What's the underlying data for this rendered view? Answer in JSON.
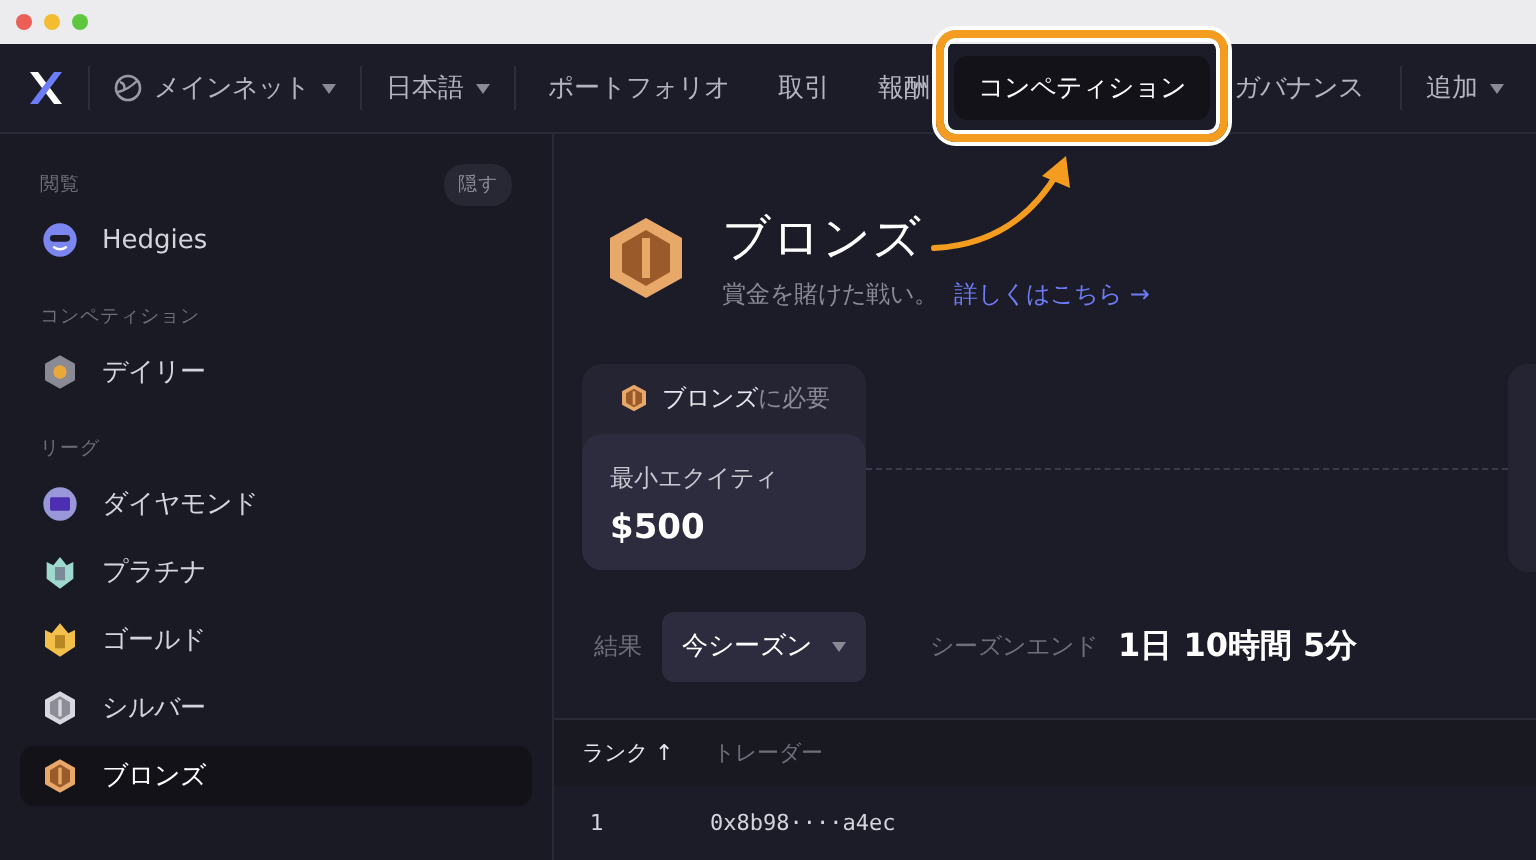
{
  "nav": {
    "network": {
      "label": "メインネット"
    },
    "language": {
      "label": "日本語"
    },
    "items": [
      {
        "label": "ポートフォリオ",
        "selected": false,
        "highlighted": false
      },
      {
        "label": "取引",
        "selected": false,
        "highlighted": false
      },
      {
        "label": "報酬",
        "selected": false,
        "highlighted": false
      },
      {
        "label": "コンペティション",
        "selected": true,
        "highlighted": true
      },
      {
        "label": "ガバナンス",
        "selected": false,
        "highlighted": false
      }
    ],
    "more": {
      "label": "追加"
    }
  },
  "sidebar": {
    "sections": [
      {
        "heading": "閲覧",
        "action": "隠す",
        "items": [
          {
            "label": "Hedgies",
            "kind": "hedgie",
            "selected": false
          }
        ]
      },
      {
        "heading": "コンペティション",
        "items": [
          {
            "label": "デイリー",
            "kind": "daily",
            "selected": false
          }
        ]
      },
      {
        "heading": "リーグ",
        "items": [
          {
            "label": "ダイヤモンド",
            "kind": "diamond",
            "selected": false
          },
          {
            "label": "プラチナ",
            "kind": "platinum",
            "selected": false
          },
          {
            "label": "ゴールド",
            "kind": "gold",
            "selected": false
          },
          {
            "label": "シルバー",
            "kind": "silver",
            "selected": false
          },
          {
            "label": "ブロンズ",
            "kind": "bronze",
            "selected": true
          }
        ]
      }
    ]
  },
  "league": {
    "kind": "bronze",
    "title": "ブロンズ",
    "subtitle": "賞金を賭けた戦い。",
    "link": "詳しくはこちら →"
  },
  "requirements": {
    "kind": "bronze",
    "label": "**ブロンズ**に必要",
    "metric": "最小エクイティ",
    "value": "$500"
  },
  "results": {
    "label": "結果",
    "season": "今シーズン",
    "season_end_label": "シーズンエンド",
    "season_end": "1日 10時間 5分",
    "columns": [
      {
        "label": "ランク ↑",
        "sorted": true
      },
      {
        "label": "トレーダー",
        "sorted": false
      }
    ],
    "rows": [
      [
        "1",
        "0x8b98····a4ec"
      ]
    ]
  }
}
